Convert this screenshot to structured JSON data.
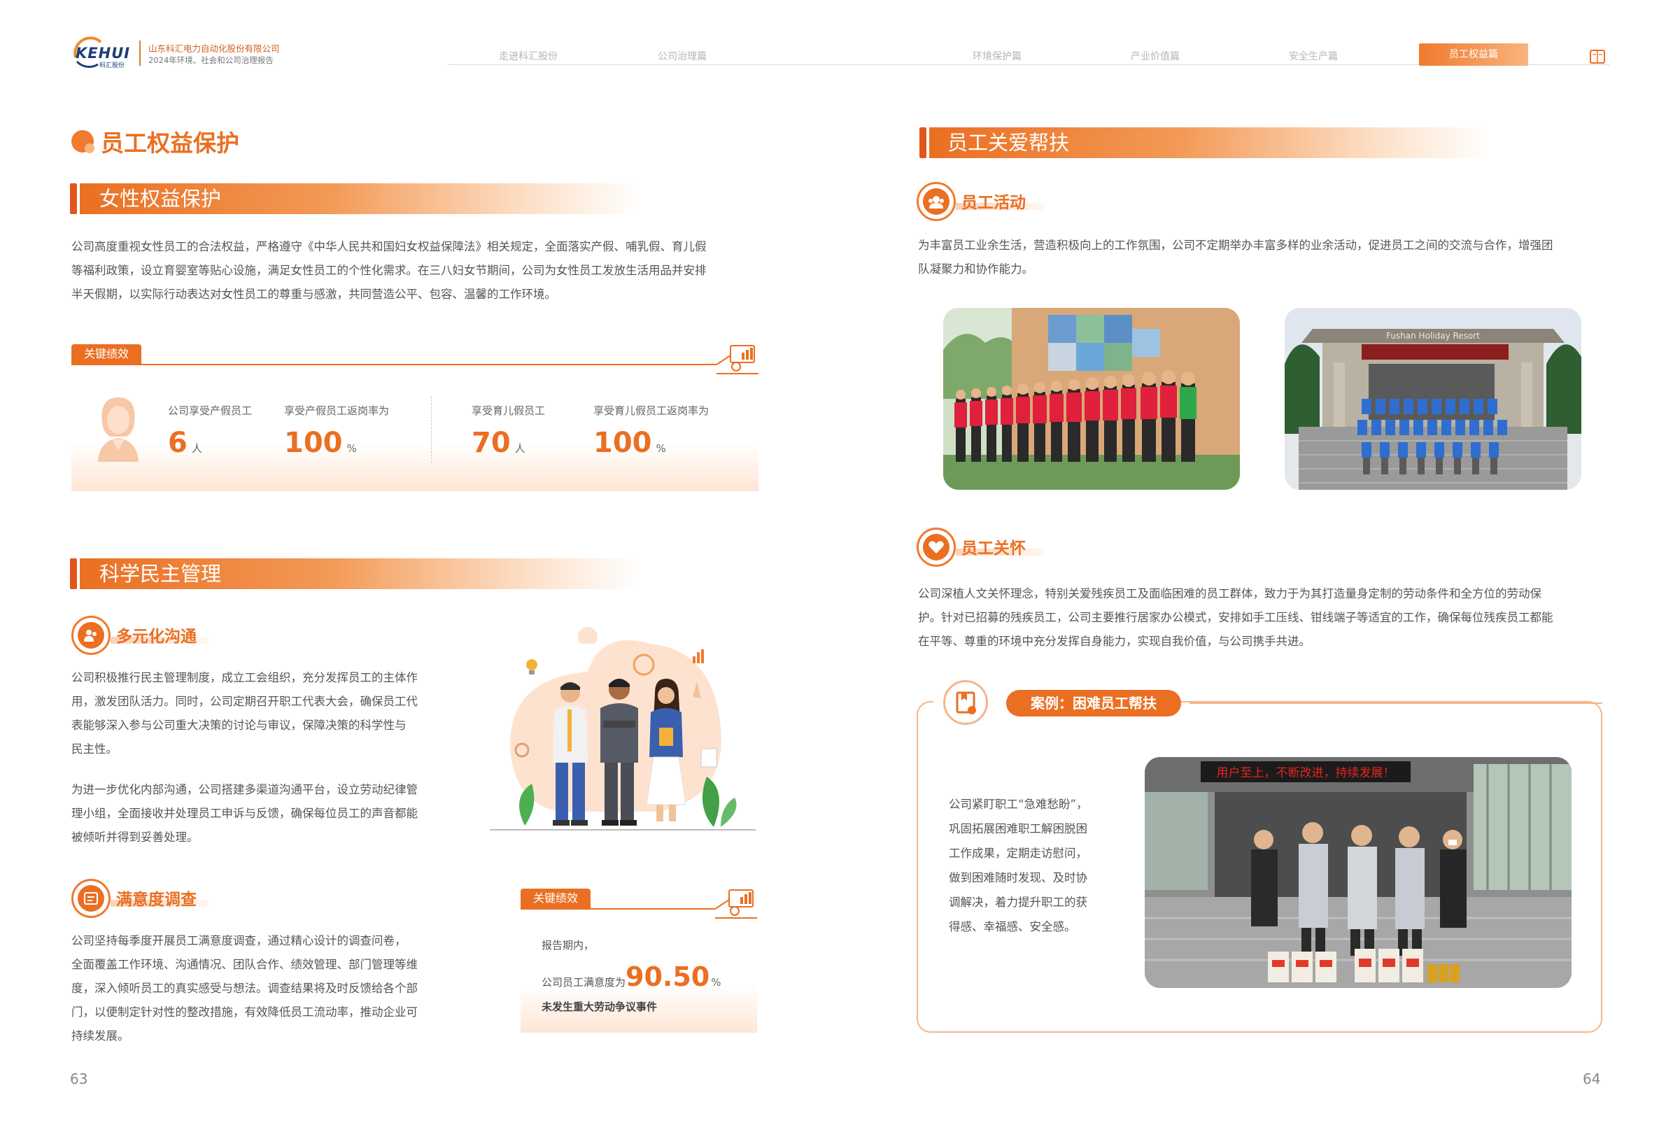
{
  "header": {
    "logo": "KEHUI",
    "logo_sub": "科汇股份",
    "company": "山东科汇电力自动化股份有限公司",
    "report": "2024年环境、社会和公司治理报告",
    "nav": [
      {
        "label": "走进科汇股份"
      },
      {
        "label": "公司治理篇"
      },
      {
        "label": "环境保护篇"
      },
      {
        "label": "产业价值篇"
      },
      {
        "label": "安全生产篇"
      },
      {
        "label": "员工权益篇"
      }
    ],
    "active_nav": "员工权益篇"
  },
  "left": {
    "main_title": "员工权益保护",
    "women": {
      "title": "女性权益保护",
      "lines": [
        "公司高度重视女性员工的合法权益，严格遵守《中华人民共和国妇女权益保障法》相关规定，全面落实产假、哺乳假、育儿假",
        "等福利政策，设立育婴室等贴心设施，满足女性员工的个性化需求。在三八妇女节期间，公司为女性员工发放生活用品并安排",
        "半天假期，以实际行动表达对女性员工的尊重与感激，共同营造公平、包容、温馨的工作环境。"
      ],
      "kpi_tag": "关键绩效",
      "kpis": [
        {
          "label": "公司享受产假员工",
          "value": "6",
          "unit": "人"
        },
        {
          "label": "享受产假员工返岗率为",
          "value": "100",
          "unit": "%"
        },
        {
          "label": "享受育儿假员工",
          "value": "70",
          "unit": "人"
        },
        {
          "label": "享受育儿假员工返岗率为",
          "value": "100",
          "unit": "%"
        }
      ]
    },
    "democracy": {
      "title": "科学民主管理",
      "communication": {
        "title": "多元化沟通",
        "p1": [
          "公司积极推行民主管理制度，成立工会组织，充分发挥员工的主体作",
          "用，激发团队活力。同时，公司定期召开职工代表大会，确保员工代",
          "表能够深入参与公司重大决策的讨论与审议，保障决策的科学性与",
          "民主性。"
        ],
        "p2": [
          "为进一步优化内部沟通，公司搭建多渠道沟通平台，设立劳动纪律管",
          "理小组，全面接收并处理员工申诉与反馈，确保每位员工的声音都能",
          "被倾听并得到妥善处理。"
        ]
      },
      "survey": {
        "title": "满意度调查",
        "lines": [
          "公司坚持每季度开展员工满意度调查，通过精心设计的调查问卷，",
          "全面覆盖工作环境、沟通情况、团队合作、绩效管理、部门管理等维",
          "度，深入倾听员工的真实感受与想法。调查结果将及时反馈给各个部",
          "门，以便制定针对性的整改措施，有效降低员工流动率，推动企业可",
          "持续发展。"
        ],
        "kpi_tag": "关键绩效",
        "kpi_line1": "报告期内，",
        "kpi_label": "公司员工满意度为",
        "kpi_value": "90.50",
        "kpi_unit": "%",
        "kpi_line3": "未发生重大劳动争议事件"
      }
    },
    "page": "63"
  },
  "right": {
    "title": "员工关爱帮扶",
    "activity": {
      "title": "员工活动",
      "lines": [
        "为丰富员工业余生活，营造积极向上的工作氛围，公司不定期举办丰富多样的业余活动，促进员工之间的交流与合作，增强团",
        "队凝聚力和协作能力。"
      ],
      "photo2_sign": "Fushan  Holiday  Resort"
    },
    "care": {
      "title": "员工关怀",
      "lines": [
        "公司深植人文关怀理念，特别关爱残疾员工及面临困难的员工群体，致力于为其打造量身定制的劳动条件和全方位的劳动保",
        "护。针对已招募的残疾员工，公司主要推行居家办公模式，安排如手工压线、钳线端子等适宜的工作，确保每位残疾员工都能",
        "在平等、尊重的环境中充分发挥自身能力，实现自我价值，与公司携手共进。"
      ]
    },
    "case": {
      "title": "案例：困难员工帮扶",
      "lines": [
        "公司紧盯职工“急难愁盼”，",
        "巩固拓展困难职工解困脱困",
        "工作成果，定期走访慰问，",
        "做到困难随时发现、及时协",
        "调解决，着力提升职工的获",
        "得感、幸福感、安全感。"
      ],
      "banner": "用户至上，不断改进，持续发展！"
    },
    "page": "64"
  },
  "colors": {
    "accent": "#ea6f22",
    "accent_light": "#f9b47e",
    "logo_blue": "#1e3d7a"
  }
}
